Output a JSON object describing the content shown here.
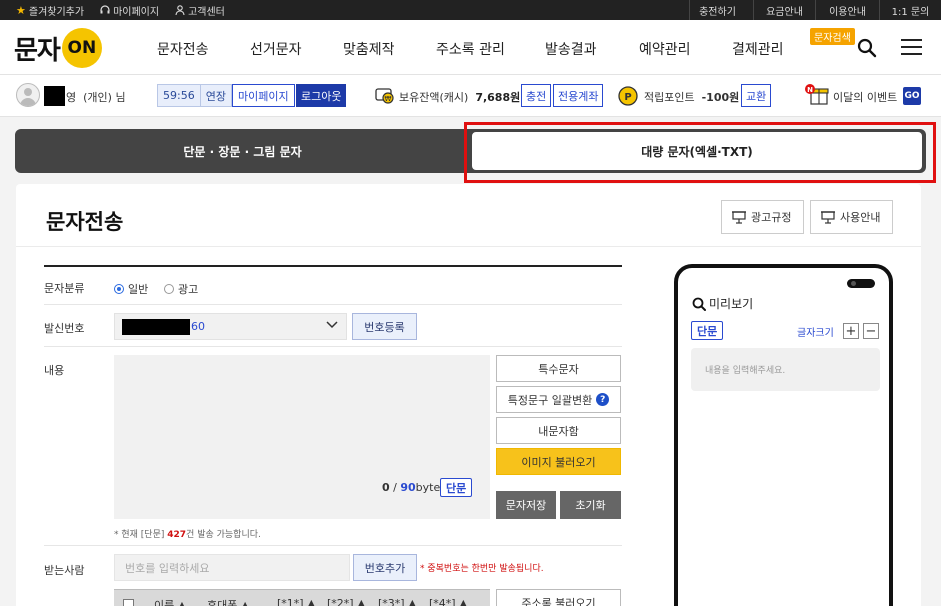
{
  "topbar": {
    "left": [
      {
        "label": "즐겨찾기추가",
        "icon": "star-icon"
      },
      {
        "label": "마이페이지",
        "icon": "headset-icon"
      },
      {
        "label": "고객센터",
        "icon": "person-icon"
      }
    ],
    "right": [
      "충전하기",
      "요금안내",
      "이용안내",
      "1:1 문의"
    ]
  },
  "header": {
    "logo_text": "문자",
    "logo_on": "ON",
    "nav": [
      "문자전송",
      "선거문자",
      "맞춤제작",
      "주소록 관리",
      "발송결과",
      "예약관리",
      "결제관리"
    ],
    "badge": "문자검색"
  },
  "userbar": {
    "name_suffix": "영",
    "user_type": "(개인) 님",
    "timer": "59:56",
    "extend": "연장",
    "mypage": "마이페이지",
    "logout": "로그아웃",
    "cash_label": "보유잔액(캐시)",
    "cash_value": "7,688원",
    "charge": "충전",
    "dedicated_account": "전용계좌",
    "point_label": "적립포인트",
    "point_value": "-100원",
    "exchange": "교환",
    "event": "이달의 이벤트",
    "event_badge": "N",
    "go": "GO"
  },
  "tabs": {
    "short": "단문 · 장문 · 그림 문자",
    "bulk": "대량 문자(엑셀·TXT)"
  },
  "main": {
    "title": "문자전송",
    "ad_rules": "광고규정",
    "usage_guide": "사용안내",
    "category_label": "문자분류",
    "category_options": [
      "일반",
      "광고"
    ],
    "sender_label": "발신번호",
    "sender_value": "60",
    "register_number": "번호등록",
    "content_label": "내용",
    "byte_used": "0",
    "byte_sep": " / ",
    "byte_max": "90",
    "byte_unit": "byte",
    "msg_type": "단문",
    "side_buttons": [
      "특수문자",
      "특정문구 일괄변환",
      "내문자함",
      "이미지 불러오기"
    ],
    "save_msg": "문자저장",
    "reset": "초기화",
    "note_prefix": "* 현재 [단문]",
    "note_count": "427",
    "note_suffix": "건 발송 가능합니다.",
    "recipient_label": "받는사람",
    "recipient_placeholder": "번호를 입력하세요",
    "add_number": "번호추가",
    "dup_note": "* 중복번호는 한번만 발송됩니다.",
    "table_headers": [
      "이름 ▲",
      "휴대폰 ▲",
      "[*1*] ▲",
      "[*2*] ▲",
      "[*3*] ▲",
      "[*4*] ▲"
    ],
    "address_load": "주소록 불러오기"
  },
  "preview": {
    "title": "미리보기",
    "type": "단문",
    "font_size": "글자크기",
    "plus": "+",
    "minus": "−",
    "placeholder": "내용을 입력해주세요."
  },
  "colors": {
    "accent_blue": "#1d3aa8",
    "logo_yellow": "#f5c400",
    "highlight_red": "#e01010",
    "image_btn": "#f7c21b"
  }
}
